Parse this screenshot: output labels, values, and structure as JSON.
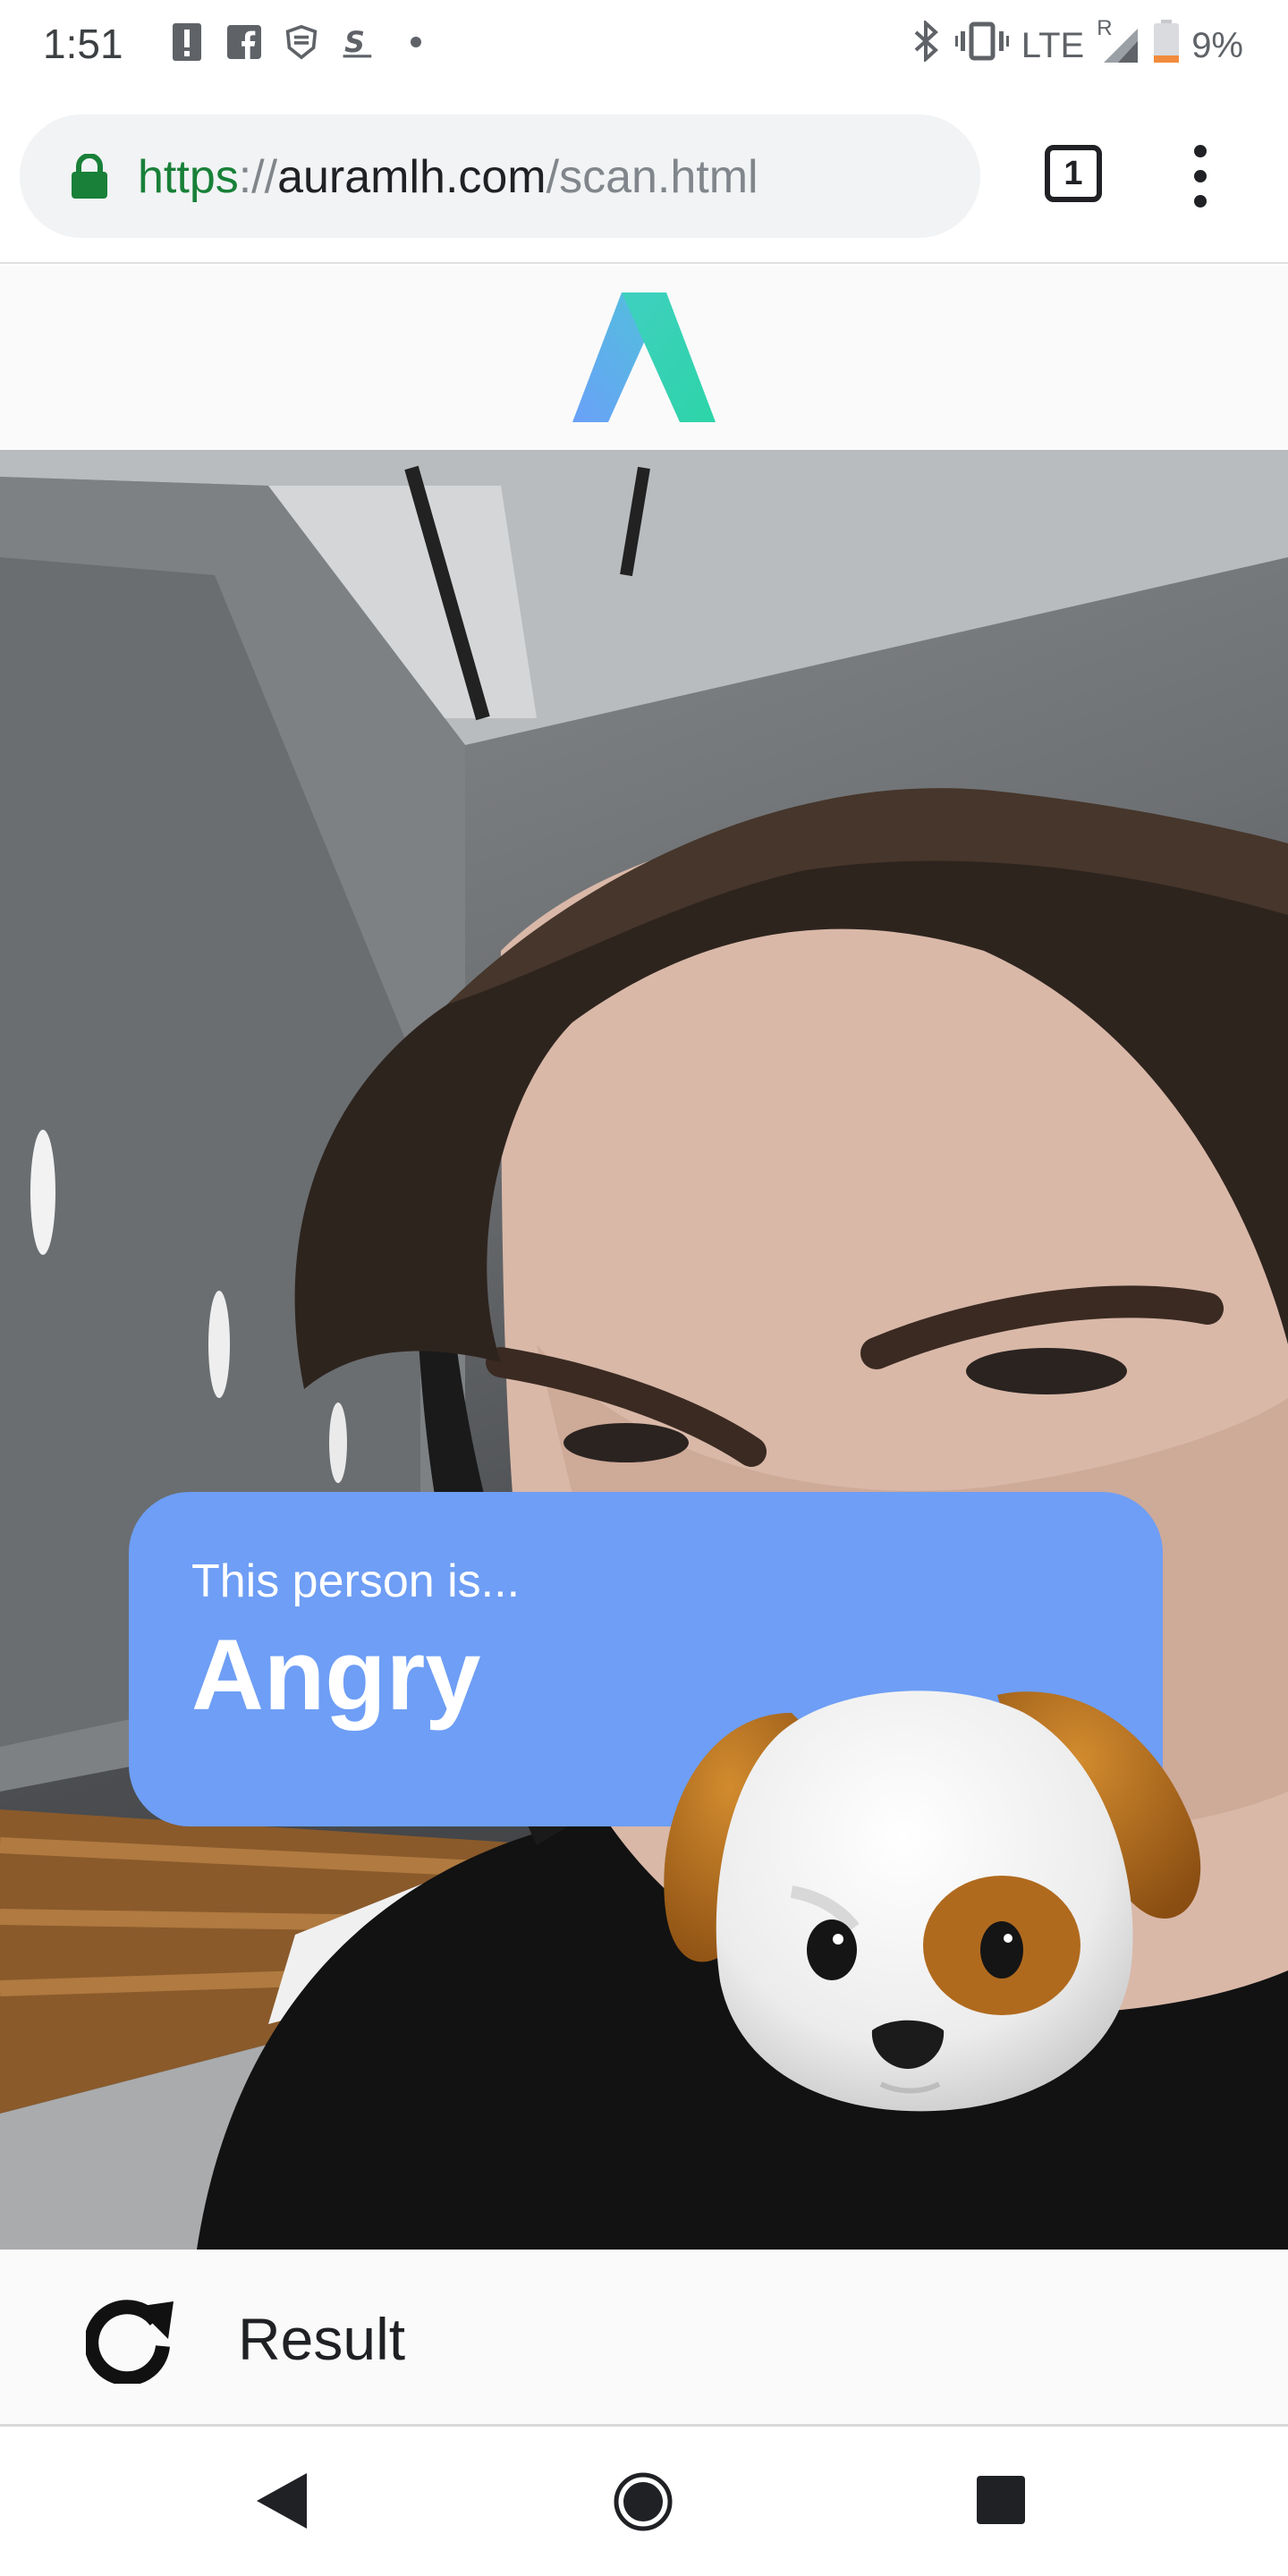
{
  "status_bar": {
    "time": "1:51",
    "network": "LTE",
    "roaming": "R",
    "battery": "9%",
    "left_icons": [
      "alert-icon",
      "facebook-icon",
      "nhl-icon",
      "s-app-icon",
      "dot-icon"
    ],
    "right_icons": [
      "bluetooth-icon",
      "vibrate-icon",
      "signal-icon",
      "battery-icon"
    ]
  },
  "browser": {
    "url_scheme": "https",
    "url_separator": "://",
    "url_host": "auramlh.com",
    "url_path": "/scan.html",
    "tab_count": "1"
  },
  "result": {
    "caption": "This person is...",
    "emotion": "Angry"
  },
  "footer": {
    "label": "Result"
  },
  "colors": {
    "card": "#6e9ef5",
    "url_scheme": "#188038",
    "logo_left": "#6aa0f8",
    "logo_right": "#2dd4a8"
  }
}
